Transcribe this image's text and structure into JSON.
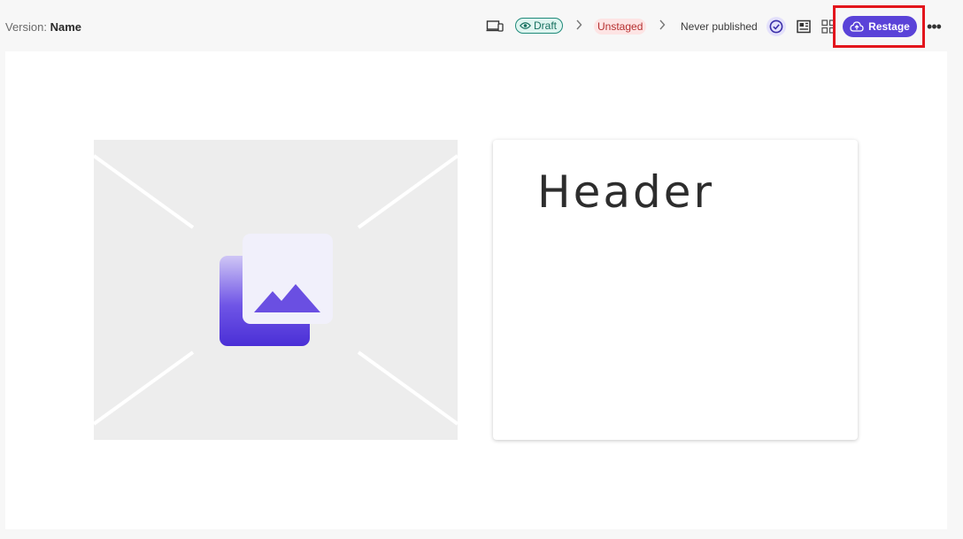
{
  "header": {
    "version_label": "Version:",
    "version_name": "Name"
  },
  "status": {
    "draft_label": "Draft",
    "unstaged_label": "Unstaged",
    "never_published_label": "Never published"
  },
  "actions": {
    "restage_label": "Restage",
    "more_label": "•••"
  },
  "icons": {
    "device": "device-preview-icon",
    "eye": "eye-icon",
    "check": "check-circle-icon",
    "contact_card": "contact-card-icon",
    "grid": "grid-layout-icon",
    "cloud_upload": "cloud-upload-icon",
    "image": "image-icon"
  },
  "colors": {
    "accent": "#5a43d8",
    "draft": "#1f8a7a",
    "unstaged": "#b53030",
    "highlight": "#e3151c"
  },
  "content": {
    "card_header": "Header"
  }
}
